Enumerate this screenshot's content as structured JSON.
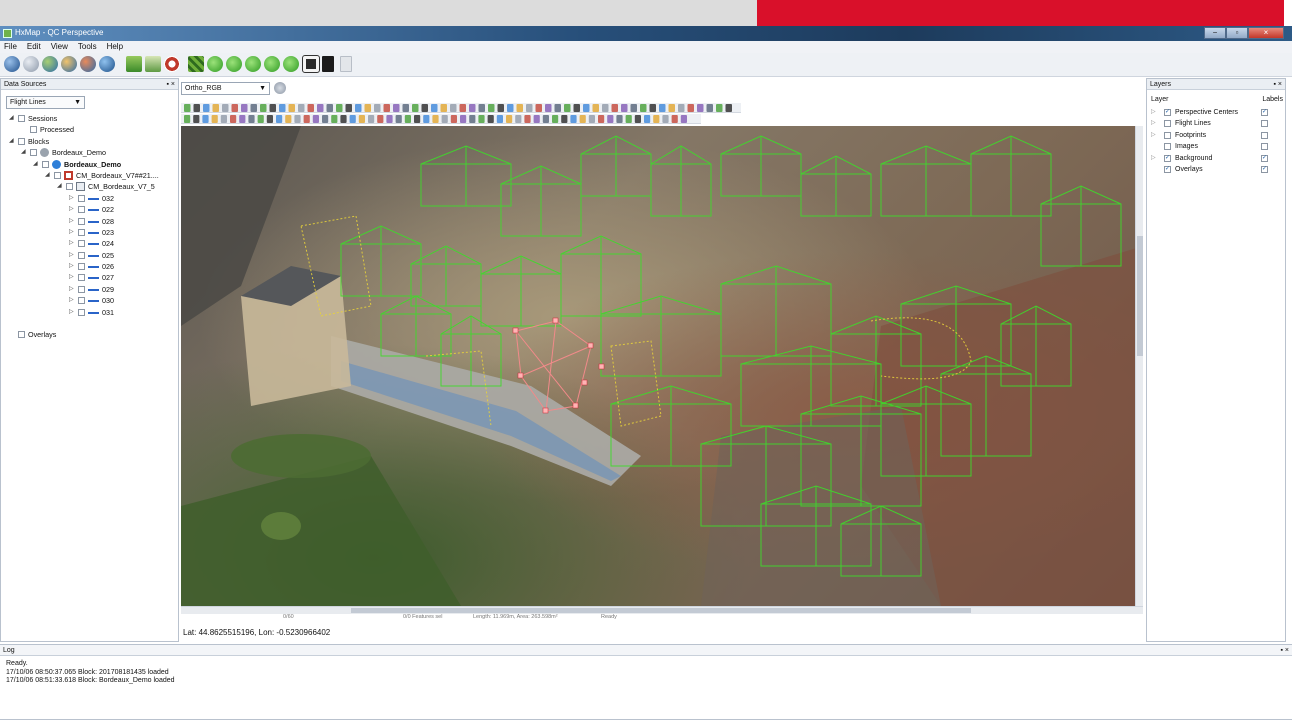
{
  "app": {
    "title": "HxMap - QC Perspective"
  },
  "window_controls": {
    "minimize": "−",
    "maximize": "▫",
    "close": "×"
  },
  "menu": {
    "items": [
      "File",
      "Edit",
      "View",
      "Tools",
      "Help"
    ]
  },
  "data_sources": {
    "title": "Data Sources",
    "panel_controls": "▪ ×",
    "dropdown": "Flight Lines",
    "tree": [
      {
        "label": "Sessions",
        "level": 0,
        "expander": "◢",
        "checkbox": true
      },
      {
        "label": "Processed",
        "level": 1,
        "expander": "",
        "checkbox": true
      },
      {
        "label": "Blocks",
        "level": 0,
        "expander": "◢",
        "checkbox": true
      },
      {
        "label": "Bordeaux_Demo",
        "level": 1,
        "expander": "◢",
        "checkbox": true,
        "icon": "database-icon"
      },
      {
        "label": "Bordeaux_Demo",
        "level": 2,
        "expander": "◢",
        "checkbox": true,
        "icon": "aircraft-icon",
        "bold": true
      },
      {
        "label": "CM_Bordeaux_V7##21....",
        "level": 3,
        "expander": "◢",
        "checkbox": true,
        "icon": "camera-model-icon"
      },
      {
        "label": "CM_Bordeaux_V7_5",
        "level": 4,
        "expander": "◢",
        "checkbox": true,
        "icon": "document-icon"
      },
      {
        "label": "032",
        "level": 5,
        "expander": "▷",
        "checkbox": true,
        "icon": "flight-line-icon"
      },
      {
        "label": "022",
        "level": 5,
        "expander": "▷",
        "checkbox": true,
        "icon": "flight-line-icon"
      },
      {
        "label": "028",
        "level": 5,
        "expander": "▷",
        "checkbox": true,
        "icon": "flight-line-icon"
      },
      {
        "label": "023",
        "level": 5,
        "expander": "▷",
        "checkbox": true,
        "icon": "flight-line-icon"
      },
      {
        "label": "024",
        "level": 5,
        "expander": "▷",
        "checkbox": true,
        "icon": "flight-line-icon"
      },
      {
        "label": "025",
        "level": 5,
        "expander": "▷",
        "checkbox": true,
        "icon": "flight-line-icon"
      },
      {
        "label": "026",
        "level": 5,
        "expander": "▷",
        "checkbox": true,
        "icon": "flight-line-icon"
      },
      {
        "label": "027",
        "level": 5,
        "expander": "▷",
        "checkbox": true,
        "icon": "flight-line-icon"
      },
      {
        "label": "029",
        "level": 5,
        "expander": "▷",
        "checkbox": true,
        "icon": "flight-line-icon"
      },
      {
        "label": "030",
        "level": 5,
        "expander": "▷",
        "checkbox": true,
        "icon": "flight-line-icon"
      },
      {
        "label": "031",
        "level": 5,
        "expander": "▷",
        "checkbox": true,
        "icon": "flight-line-icon"
      },
      {
        "label": "",
        "level": 0,
        "expander": "",
        "checkbox": false
      },
      {
        "label": "Overlays",
        "level": 0,
        "expander": "",
        "checkbox": true
      }
    ]
  },
  "view": {
    "image_select": "Ortho_RGB",
    "toolbar_row2_text": "2D 3D | P L G / X C H I",
    "toolbar_row1_text": "11 21"
  },
  "status": {
    "coords": "Lat: 44.8625515196, Lon: -0.5230966402",
    "footer": [
      "0/60",
      "0/0 Features sel",
      "Length: 11.969m, Area: 263.598m²",
      "Ready"
    ]
  },
  "layers": {
    "title": "Layers",
    "panel_controls": "▪ ×",
    "col_layer": "Layer",
    "col_labels": "Labels",
    "rows": [
      {
        "name": "Perspective Centers",
        "checked": true,
        "labels": true,
        "expandable": true
      },
      {
        "name": "Flight Lines",
        "checked": false,
        "labels": false,
        "expandable": true
      },
      {
        "name": "Footprints",
        "checked": false,
        "labels": false,
        "expandable": true
      },
      {
        "name": "Images",
        "checked": false,
        "labels": false,
        "expandable": false
      },
      {
        "name": "Background",
        "checked": true,
        "labels": true,
        "expandable": true
      },
      {
        "name": "Overlays",
        "checked": true,
        "labels": true,
        "expandable": false
      }
    ]
  },
  "log": {
    "title": "Log",
    "panel_controls": "▪ ×",
    "lines": [
      "Ready.",
      "17/10/06 08:50:37.065 Block: 201708181435 loaded",
      "17/10/06 08:51:33.618 Block: Bordeaux_Demo loaded"
    ]
  },
  "colors": {
    "accent_red": "#d9102a",
    "wireframe_green": "#3ddc2a",
    "title_blue": "#274f7a"
  }
}
